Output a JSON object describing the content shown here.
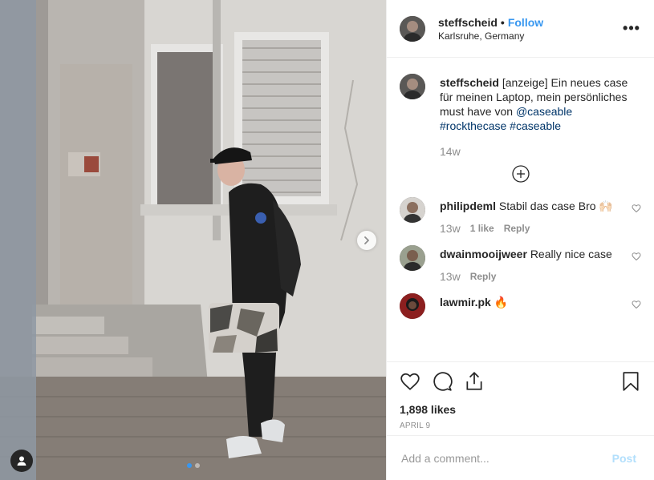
{
  "header": {
    "username": "steffscheid",
    "separator": "•",
    "follow_label": "Follow",
    "location": "Karlsruhe, Germany",
    "more_label": "•••"
  },
  "caption": {
    "username": "steffscheid",
    "text": "[anzeige] Ein neues case für meinen Laptop, mein persönliches must have von",
    "mention": "@caseable",
    "hashtag1": "#rockthecase",
    "hashtag2": "#caseable",
    "time": "14w"
  },
  "comments": [
    {
      "username": "philipdeml",
      "text": "Stabil das case Bro 🙌🏻",
      "time": "13w",
      "likes": "1 like",
      "reply": "Reply"
    },
    {
      "username": "dwainmooijweer",
      "text": "Really nice case",
      "time": "13w",
      "reply": "Reply"
    },
    {
      "username": "lawmir.pk",
      "text": "🔥"
    }
  ],
  "actions": {
    "likes": "1,898 likes",
    "date": "APRIL 9"
  },
  "add_comment": {
    "placeholder": "Add a comment...",
    "post_label": "Post"
  },
  "carousel": {
    "dots": 2,
    "active_index": 0
  },
  "colors": {
    "link": "#003569",
    "follow": "#3897f0",
    "post_disabled": "#b2dffc",
    "muted": "#8e8e8e"
  },
  "icons": [
    "next-arrow-icon",
    "user-tag-icon",
    "more-options-icon",
    "load-more-icon",
    "heart-icon",
    "comment-icon",
    "share-icon",
    "bookmark-icon"
  ]
}
